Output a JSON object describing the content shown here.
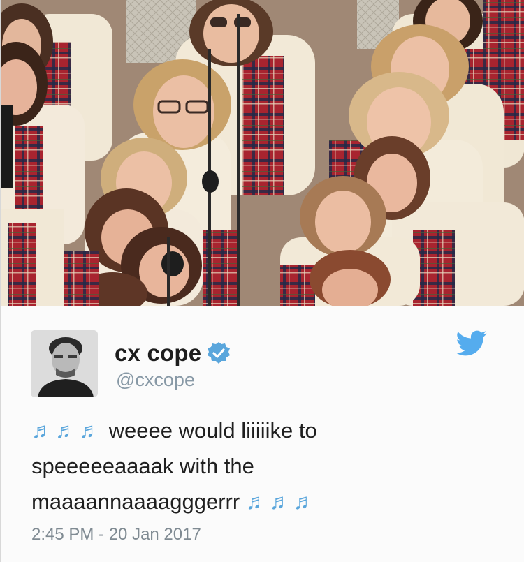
{
  "tweet": {
    "display_name": "cx cope",
    "handle": "@cxcope",
    "line1_notes": "♬♬♬",
    "line1_text": "weeee would liiiiike to",
    "line2_text": "speeeeeaaaak with the",
    "line3_text": "maaaannaaaagggerrr",
    "line3_notes": "♬♬♬",
    "timestamp": "2:45 PM - 20 Jan 2017"
  },
  "icons": {
    "verified": "verified-badge-icon",
    "bird": "twitter-bird-icon",
    "avatar": "profile-avatar"
  },
  "colors": {
    "verified_blue": "#5aa6dc",
    "twitter_blue": "#55acee",
    "handle_gray": "#8899a6",
    "text": "#1f1f1f",
    "plaid_red": "#a8242f",
    "sweater_cream": "#f0e7d4"
  }
}
